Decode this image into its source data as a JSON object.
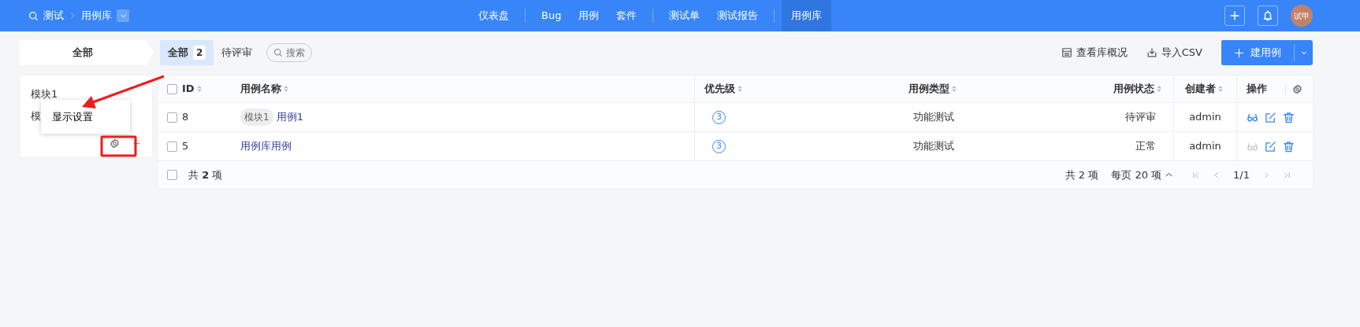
{
  "topbar": {
    "product": "测试",
    "library": "用例库",
    "nav": [
      {
        "label": "仪表盘",
        "selected": false,
        "divider_after": true
      },
      {
        "label": "Bug",
        "selected": false,
        "divider_after": false
      },
      {
        "label": "用例",
        "selected": false,
        "divider_after": false
      },
      {
        "label": "套件",
        "selected": false,
        "divider_after": true
      },
      {
        "label": "测试单",
        "selected": false,
        "divider_after": false
      },
      {
        "label": "测试报告",
        "selected": false,
        "divider_after": true
      },
      {
        "label": "用例库",
        "selected": true,
        "divider_after": false
      }
    ],
    "avatar": "试甲"
  },
  "toolbar": {
    "crumb": "全部",
    "tabs": [
      {
        "label": "全部",
        "count": "2",
        "selected": true
      },
      {
        "label": "待评审",
        "selected": false
      }
    ],
    "search": {
      "placeholder": "搜索"
    },
    "overview": "查看库概况",
    "import": "导入CSV",
    "create": "建用例"
  },
  "sidebar": {
    "items": [
      "模块1",
      "模"
    ],
    "menu": {
      "item": "显示设置"
    }
  },
  "table": {
    "columns": [
      {
        "label": "ID",
        "sortable": true
      },
      {
        "label": "用例名称",
        "sortable": true
      },
      {
        "label": "优先级",
        "sortable": true
      },
      {
        "label": "用例类型",
        "sortable": true
      },
      {
        "label": "用例状态",
        "sortable": true
      },
      {
        "label": "创建者",
        "sortable": true
      },
      {
        "label": "操作",
        "sortable": false
      }
    ],
    "rows": [
      {
        "checked": false,
        "id": "8",
        "module": "模块1",
        "name": "用例1",
        "priority": "3",
        "type": "功能测试",
        "status": "待评审",
        "creator": "admin",
        "view_disabled": false
      },
      {
        "checked": false,
        "id": "5",
        "name": "用例库用例",
        "priority": "3",
        "type": "功能测试",
        "status": "正常",
        "creator": "admin",
        "view_disabled": true
      }
    ],
    "header_checked": false,
    "footer": {
      "checked": false,
      "total": "共 **2** 项",
      "count": "共 2 项",
      "per_page": "每页 20 项",
      "page": "1/1"
    }
  }
}
